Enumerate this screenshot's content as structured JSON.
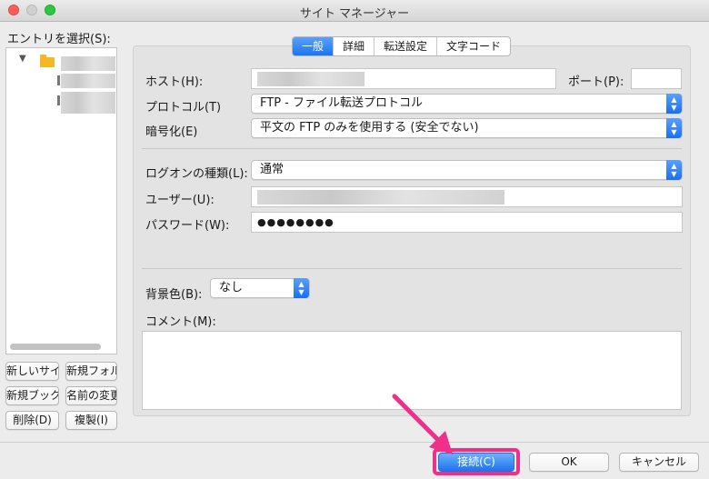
{
  "window": {
    "title": "サイト マネージャー"
  },
  "sidebar": {
    "entry_label": "エントリを選択(S):",
    "buttons": {
      "new_site": "新しいサイト",
      "new_folder": "新規フォルダ",
      "new_bookmark": "新規ブックマーク",
      "rename": "名前の変更",
      "delete": "削除(D)",
      "duplicate": "複製(I)"
    }
  },
  "tabs": [
    {
      "label": "一般",
      "active": true
    },
    {
      "label": "詳細",
      "active": false
    },
    {
      "label": "転送設定",
      "active": false
    },
    {
      "label": "文字コード",
      "active": false
    }
  ],
  "form": {
    "host_label": "ホスト(H):",
    "port_label": "ポート(P):",
    "port_value": "",
    "protocol_label": "プロトコル(T)",
    "protocol_value": "FTP - ファイル転送プロトコル",
    "encryption_label": "暗号化(E)",
    "encryption_value": "平文の FTP のみを使用する (安全でない)",
    "logon_label": "ログオンの種類(L):",
    "logon_value": "通常",
    "user_label": "ユーザー(U):",
    "password_label": "パスワード(W):",
    "password_value": "●●●●●●●●",
    "bgcolor_label": "背景色(B):",
    "bgcolor_value": "なし",
    "comment_label": "コメント(M):",
    "comment_value": ""
  },
  "footer": {
    "connect": "接続(C)",
    "ok": "OK",
    "cancel": "キャンセル"
  },
  "colors": {
    "accent": "#1a75f2",
    "highlight": "#ef2f8a"
  }
}
